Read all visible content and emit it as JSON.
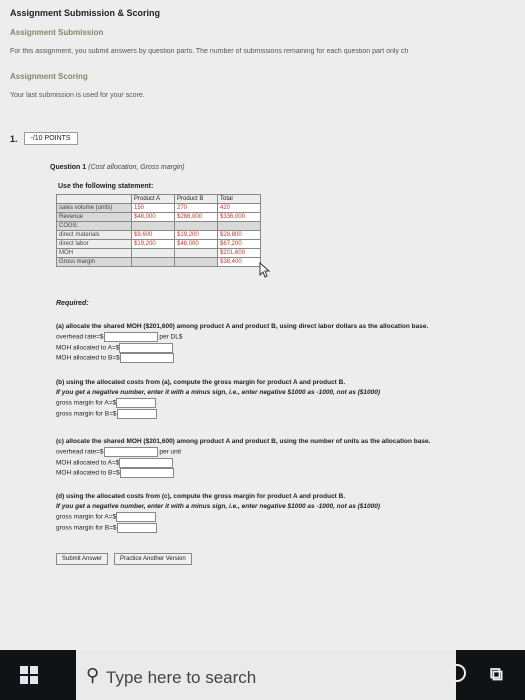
{
  "header": {
    "title": "Assignment Submission & Scoring",
    "submission_title": "Assignment Submission",
    "submission_text": "For this assignment, you submit answers by question parts. The number of submissions remaining for each question part only ch",
    "scoring_title": "Assignment Scoring",
    "scoring_text": "Your last submission is used for your score."
  },
  "question": {
    "number": "1.",
    "points": "-/10 POINTS",
    "title": "Question 1",
    "title_detail": "(Cost allocation, Gross margin)",
    "instruction": "Use the following statement:"
  },
  "table": {
    "headers": [
      "",
      "Product A",
      "Product B",
      "Total"
    ],
    "rows": [
      {
        "label": "sales volume (units)",
        "a": "150",
        "b": "270",
        "t": "420"
      },
      {
        "label": "Revenue",
        "a": "$48,000",
        "b": "$288,000",
        "t": "$336,000"
      },
      {
        "label": "COGS:",
        "a": "",
        "b": "",
        "t": ""
      },
      {
        "label": "direct materials",
        "a": "$9,600",
        "b": "$19,200",
        "t": "$28,800"
      },
      {
        "label": "direct labor",
        "a": "$19,200",
        "b": "$48,000",
        "t": "$67,200"
      },
      {
        "label": "MOH",
        "a": "",
        "b": "",
        "t": "$201,600"
      },
      {
        "label": "Gross margin",
        "a": "",
        "b": "",
        "t": "$38,400"
      }
    ]
  },
  "required": "Required:",
  "part_a": {
    "q": "(a) allocate the shared MOH ($201,600) among product A and product B, using direct labor dollars as the allocation base.",
    "rate_label": "overhead rate=$",
    "rate_unit": "per DL$",
    "a_label": "MOH allocated to A=$",
    "b_label": "MOH allocated to B=$"
  },
  "part_b": {
    "q": "(b) using the allocated costs from (a), compute the gross margin for product A and product B.",
    "note": "If you get a negative number, enter it with a minus sign, i.e., enter negative $1000 as -1000, not as ($1000)",
    "a_label": "gross margin for A=$",
    "b_label": "gross margin for B=$"
  },
  "part_c": {
    "q": "(c) allocate the shared MOH ($201,600) among product A and product B, using the number of units as the allocation base.",
    "rate_label": "overhead rate=$",
    "rate_unit": "per unit",
    "a_label": "MOH allocated to A=$",
    "b_label": "MOH allocated to B=$"
  },
  "part_d": {
    "q": "(d) using the allocated costs from (c), compute the gross margin for product A and product B.",
    "note": "If you get a negative number, enter it with a minus sign, i.e., enter negative $1000 as -1000, not as ($1000)",
    "a_label": "gross margin for A=$",
    "b_label": "gross margin for B=$"
  },
  "buttons": {
    "submit": "Submit Answer",
    "practice": "Practice Another Version"
  },
  "taskbar": {
    "search_placeholder": "Type here to search"
  },
  "colors": {
    "header_green": "#7a8c6a",
    "taskbar": "#101216"
  }
}
